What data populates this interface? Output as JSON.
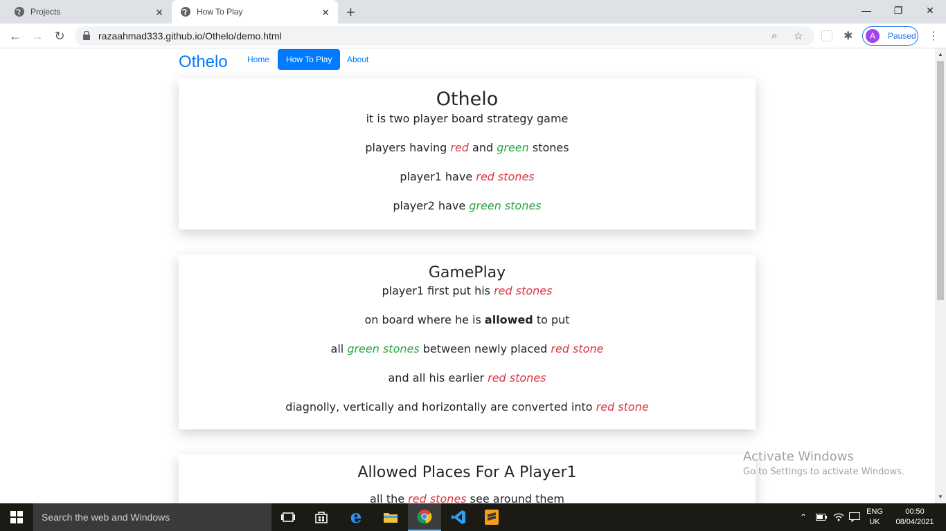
{
  "browser": {
    "tabs": [
      {
        "title": "Projects",
        "active": false
      },
      {
        "title": "How To Play",
        "active": true
      }
    ],
    "url": "razaahmad333.github.io/Othelo/demo.html",
    "profile_initial": "A",
    "profile_status": "Paused"
  },
  "site": {
    "brand": "Othelo",
    "nav": [
      {
        "label": "Home",
        "active": false
      },
      {
        "label": "How To Play",
        "active": true
      },
      {
        "label": "About",
        "active": false
      }
    ]
  },
  "sections": {
    "intro": {
      "title": "Othelo",
      "line1": "it is two player board strategy game",
      "line2": {
        "a": "players having ",
        "b": "red",
        "c": " and ",
        "d": "green",
        "e": " stones"
      },
      "line3": {
        "a": "player1 have ",
        "b": "red stones"
      },
      "line4": {
        "a": "player2 have ",
        "b": "green stones"
      }
    },
    "gameplay": {
      "title": "GamePlay",
      "line1": {
        "a": "player1 first put his ",
        "b": "red stones"
      },
      "line2": {
        "a": "on board where he is ",
        "b": "allowed",
        "c": " to put"
      },
      "line3": {
        "a": "all ",
        "b": "green stones",
        "c": " between newly placed ",
        "d": "red stone"
      },
      "line4": {
        "a": "and all his earlier ",
        "b": "red stones"
      },
      "line5": {
        "a": "diagnolly, vertically and horizontally are converted into ",
        "b": "red stone"
      }
    },
    "allowed": {
      "title": "Allowed Places For A Player1",
      "line1": {
        "a": "all the ",
        "b": "red stones",
        "c": " see around them"
      }
    }
  },
  "watermark": {
    "title": "Activate Windows",
    "subtitle": "Go to Settings to activate Windows."
  },
  "taskbar": {
    "search_placeholder": "Search the web and Windows",
    "lang": "ENG",
    "region": "UK",
    "time": "00:50",
    "date": "08/04/2021"
  },
  "colors": {
    "primary": "#007bff",
    "red_text": "#dc3545",
    "green_text": "#28a745"
  }
}
